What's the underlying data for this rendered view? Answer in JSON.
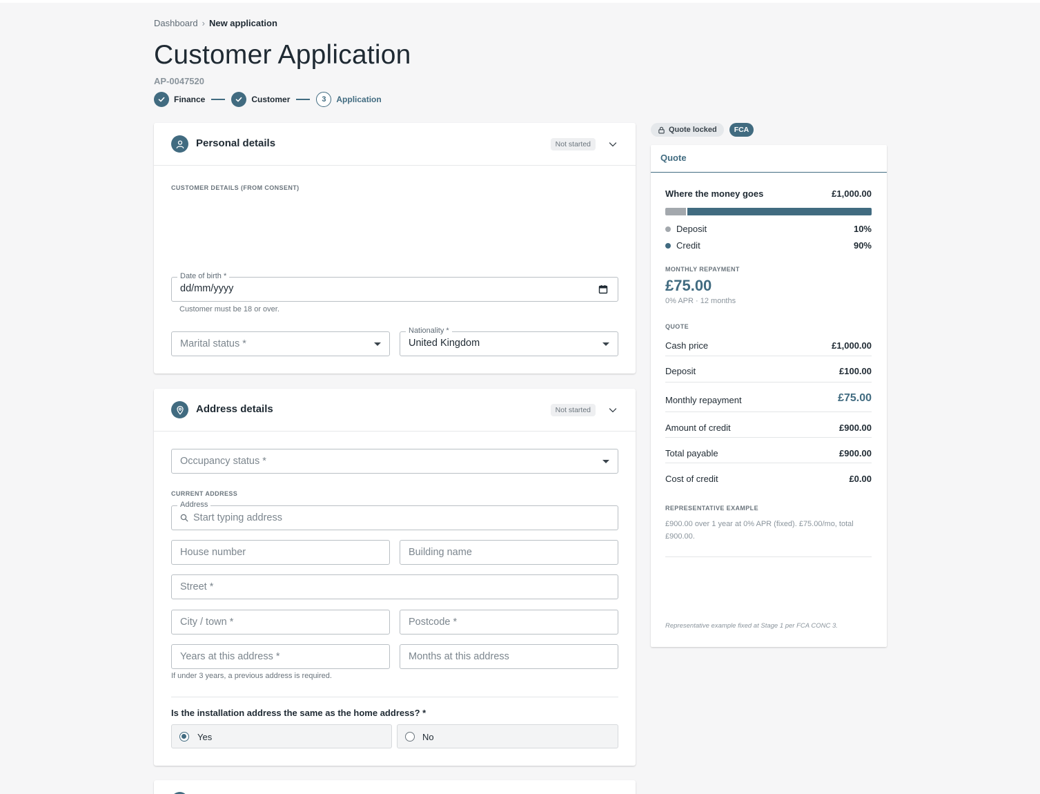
{
  "breadcrumb": {
    "parent": "Dashboard",
    "separator": "›",
    "current": "New application"
  },
  "page": {
    "title": "Customer Application",
    "application_id": "AP-0047520"
  },
  "stepper": {
    "steps": [
      {
        "label": "Finance",
        "state": "done"
      },
      {
        "label": "Customer",
        "state": "done"
      },
      {
        "label": "Application",
        "state": "current",
        "number": "3"
      }
    ]
  },
  "personal": {
    "title": "Personal details",
    "status": "Not started",
    "section_label": "CUSTOMER DETAILS (FROM CONSENT)",
    "dob_label": "Date of birth *",
    "dob_value": "dd/mm/yyyy",
    "dob_helper": "Customer must be 18 or over.",
    "marital_placeholder": "Marital status *",
    "nationality_label": "Nationality *",
    "nationality_value": "United Kingdom"
  },
  "address": {
    "title": "Address details",
    "status": "Not started",
    "occupancy_placeholder": "Occupancy status *",
    "current_label": "CURRENT ADDRESS",
    "address_label": "Address",
    "address_placeholder": "Start typing address",
    "house_number": "House number",
    "building_name": "Building name",
    "street": "Street *",
    "city": "City / town *",
    "postcode": "Postcode *",
    "years": "Years at this address *",
    "months": "Months at this address",
    "helper": "If under 3 years, a previous address is required.",
    "question": "Is the installation address the same as the home address? *",
    "yes": "Yes",
    "no": "No",
    "selected": "Yes"
  },
  "quote": {
    "locked_label": "Quote locked",
    "fca_label": "FCA",
    "tab": "Quote",
    "money_title": "Where the money goes",
    "money_total": "£1,000.00",
    "deposit_label": "Deposit",
    "deposit_pct": "10%",
    "deposit_fraction": 0.1,
    "credit_label": "Credit",
    "credit_pct": "90%",
    "monthly_label": "MONTHLY REPAYMENT",
    "monthly_amount": "£75.00",
    "monthly_sub": "0% APR · 12 months",
    "quote_label": "QUOTE",
    "rows": [
      {
        "k": "Cash price",
        "v": "£1,000.00"
      },
      {
        "k": "Deposit",
        "v": "£100.00"
      },
      {
        "k": "Monthly repayment",
        "v": "£75.00"
      },
      {
        "k": "Amount of credit",
        "v": "£900.00"
      },
      {
        "k": "Total payable",
        "v": "£900.00"
      },
      {
        "k": "Cost of credit",
        "v": "£0.00"
      }
    ],
    "rep_label": "REPRESENTATIVE EXAMPLE",
    "rep_text": "£900.00 over 1 year at 0% APR (fixed). £75.00/mo, total £900.00.",
    "footnote": "Representative example fixed at Stage 1 per FCA CONC 3."
  },
  "colors": {
    "accent": "#416b80",
    "deposit": "#a3a8ad",
    "background": "#f6f6f7"
  }
}
